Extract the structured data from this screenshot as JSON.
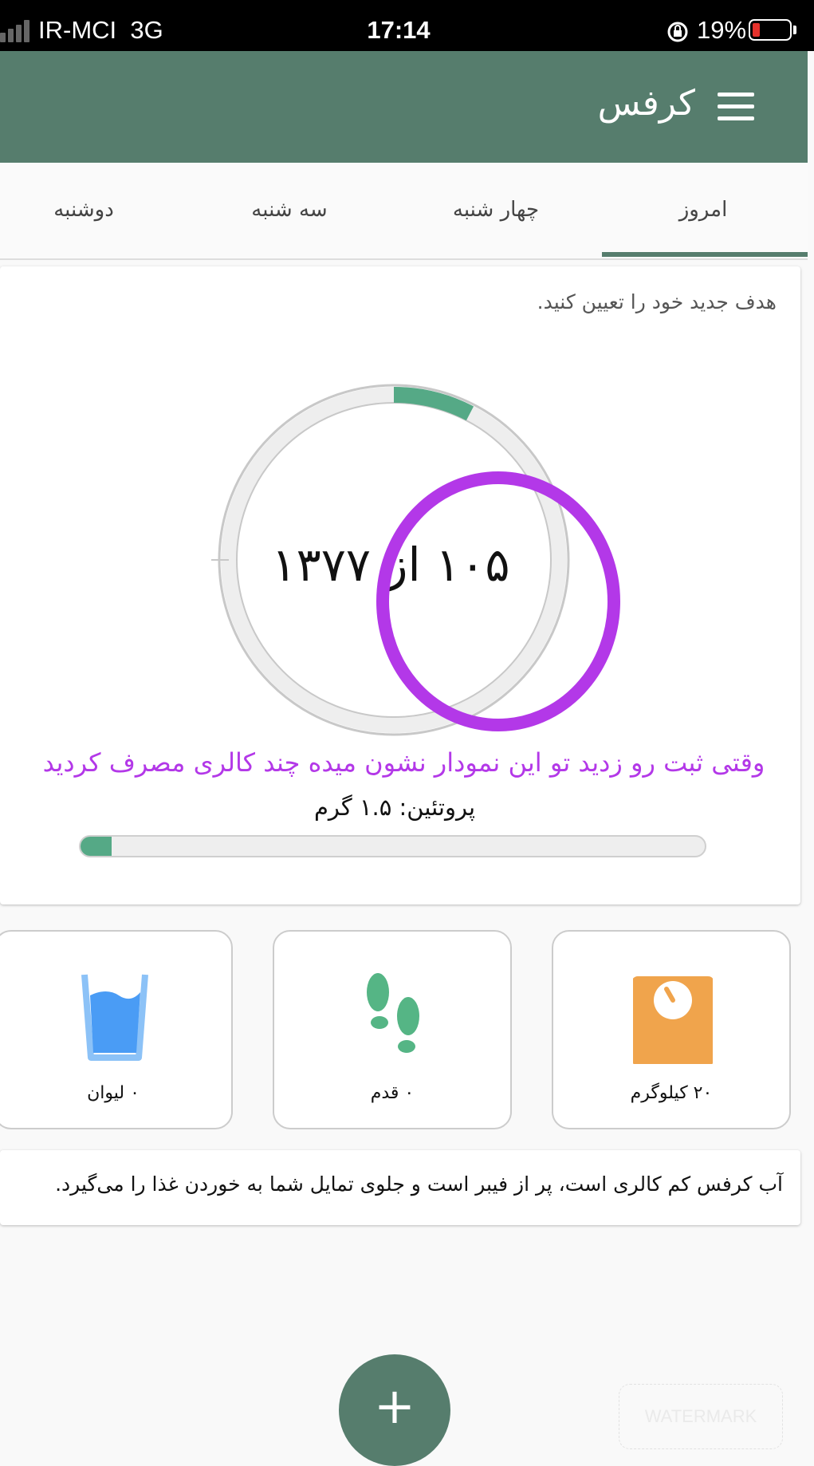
{
  "status_bar": {
    "carrier": "IR-MCI",
    "network": "3G",
    "time": "17:14",
    "battery": "19%"
  },
  "app_bar": {
    "title": "کرفس",
    "menu_icon": "hamburger-menu-icon",
    "color": "#567d6d"
  },
  "tabs": [
    {
      "label": "امروز",
      "active": true
    },
    {
      "label": "چهار شنبه",
      "active": false
    },
    {
      "label": "سه شنبه",
      "active": false
    },
    {
      "label": "دوشنبه",
      "active": false
    }
  ],
  "calorie_card": {
    "goal_link": "هدف جدید خود را تعیین کنید.",
    "ring_text": "۱۰۵ از ۱۳۷۷",
    "consumed": 105,
    "goal": 1377,
    "ring_color": "#55a986",
    "annotation": "وقتی ثبت رو زدید تو این نمودار نشون میده چند کالری مصرف کردید",
    "annotation_color": "#b338e8",
    "protein_label": "پروتئین: ۱.۵ گرم",
    "protein_fraction": 0.05
  },
  "tiles": [
    {
      "label": "۲۰ کیلوگرم",
      "icon": "scale-icon",
      "color": "#f0a44c"
    },
    {
      "label": "۰ قدم",
      "icon": "footsteps-icon",
      "color": "#55b585"
    },
    {
      "label": "۰ لیوان",
      "icon": "water-glass-icon",
      "color": "#4a9cf5"
    }
  ],
  "tip": {
    "text": "آب کرفس کم کالری است، پر از فیبر است و جلوی تمایل شما به خوردن غذا را می‌گیرد."
  },
  "fab": {
    "label": "+"
  },
  "watermark": "WATERMARK"
}
